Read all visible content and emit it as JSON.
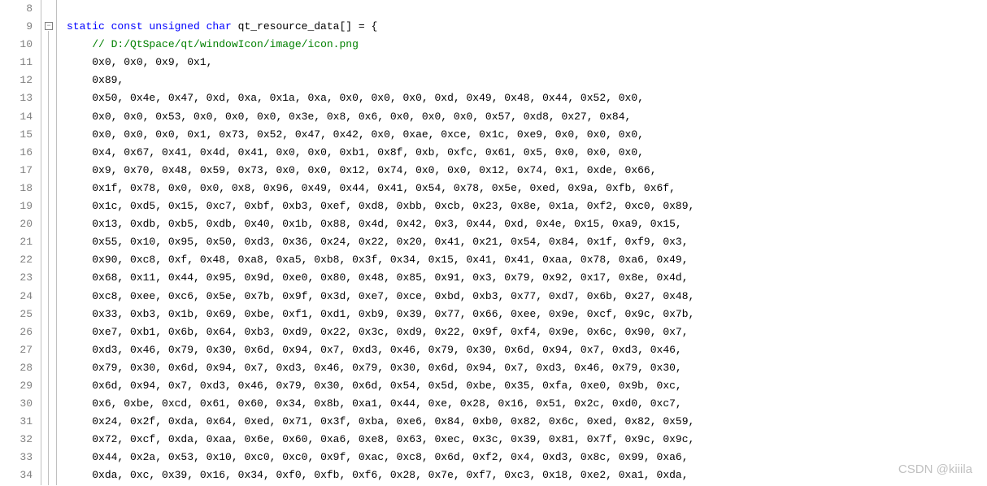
{
  "watermark": "CSDN @kiiila",
  "fold_marker": "−",
  "lines": [
    {
      "num": "8",
      "content": []
    },
    {
      "num": "9",
      "content": [
        {
          "text": "static const unsigned char ",
          "cls": "kw"
        },
        {
          "text": "qt_resource_data[] = {",
          "cls": "ident"
        }
      ]
    },
    {
      "num": "10",
      "indent": "    ",
      "content": [
        {
          "text": "// D:/QtSpace/qt/windowIcon/image/icon.png",
          "cls": "comment"
        }
      ]
    },
    {
      "num": "11",
      "indent": "    ",
      "content": [
        {
          "text": "0x0, 0x0, 0x9, 0x1,",
          "cls": "ident"
        }
      ]
    },
    {
      "num": "12",
      "indent": "    ",
      "content": [
        {
          "text": "0x89,",
          "cls": "ident"
        }
      ]
    },
    {
      "num": "13",
      "indent": "    ",
      "content": [
        {
          "text": "0x50, 0x4e, 0x47, 0xd, 0xa, 0x1a, 0xa, 0x0, 0x0, 0x0, 0xd, 0x49, 0x48, 0x44, 0x52, 0x0,",
          "cls": "ident"
        }
      ]
    },
    {
      "num": "14",
      "indent": "    ",
      "content": [
        {
          "text": "0x0, 0x0, 0x53, 0x0, 0x0, 0x0, 0x3e, 0x8, 0x6, 0x0, 0x0, 0x0, 0x57, 0xd8, 0x27, 0x84,",
          "cls": "ident"
        }
      ]
    },
    {
      "num": "15",
      "indent": "    ",
      "content": [
        {
          "text": "0x0, 0x0, 0x0, 0x1, 0x73, 0x52, 0x47, 0x42, 0x0, 0xae, 0xce, 0x1c, 0xe9, 0x0, 0x0, 0x0,",
          "cls": "ident"
        }
      ]
    },
    {
      "num": "16",
      "indent": "    ",
      "content": [
        {
          "text": "0x4, 0x67, 0x41, 0x4d, 0x41, 0x0, 0x0, 0xb1, 0x8f, 0xb, 0xfc, 0x61, 0x5, 0x0, 0x0, 0x0,",
          "cls": "ident"
        }
      ]
    },
    {
      "num": "17",
      "indent": "    ",
      "content": [
        {
          "text": "0x9, 0x70, 0x48, 0x59, 0x73, 0x0, 0x0, 0x12, 0x74, 0x0, 0x0, 0x12, 0x74, 0x1, 0xde, 0x66,",
          "cls": "ident"
        }
      ]
    },
    {
      "num": "18",
      "indent": "    ",
      "content": [
        {
          "text": "0x1f, 0x78, 0x0, 0x0, 0x8, 0x96, 0x49, 0x44, 0x41, 0x54, 0x78, 0x5e, 0xed, 0x9a, 0xfb, 0x6f,",
          "cls": "ident"
        }
      ]
    },
    {
      "num": "19",
      "indent": "    ",
      "content": [
        {
          "text": "0x1c, 0xd5, 0x15, 0xc7, 0xbf, 0xb3, 0xef, 0xd8, 0xbb, 0xcb, 0x23, 0x8e, 0x1a, 0xf2, 0xc0, 0x89,",
          "cls": "ident"
        }
      ]
    },
    {
      "num": "20",
      "indent": "    ",
      "content": [
        {
          "text": "0x13, 0xdb, 0xb5, 0xdb, 0x40, 0x1b, 0x88, 0x4d, 0x42, 0x3, 0x44, 0xd, 0x4e, 0x15, 0xa9, 0x15,",
          "cls": "ident"
        }
      ]
    },
    {
      "num": "21",
      "indent": "    ",
      "content": [
        {
          "text": "0x55, 0x10, 0x95, 0x50, 0xd3, 0x36, 0x24, 0x22, 0x20, 0x41, 0x21, 0x54, 0x84, 0x1f, 0xf9, 0x3,",
          "cls": "ident"
        }
      ]
    },
    {
      "num": "22",
      "indent": "    ",
      "content": [
        {
          "text": "0x90, 0xc8, 0xf, 0x48, 0xa8, 0xa5, 0xb8, 0x3f, 0x34, 0x15, 0x41, 0x41, 0xaa, 0x78, 0xa6, 0x49,",
          "cls": "ident"
        }
      ]
    },
    {
      "num": "23",
      "indent": "    ",
      "content": [
        {
          "text": "0x68, 0x11, 0x44, 0x95, 0x9d, 0xe0, 0x80, 0x48, 0x85, 0x91, 0x3, 0x79, 0x92, 0x17, 0x8e, 0x4d,",
          "cls": "ident"
        }
      ]
    },
    {
      "num": "24",
      "indent": "    ",
      "content": [
        {
          "text": "0xc8, 0xee, 0xc6, 0x5e, 0x7b, 0x9f, 0x3d, 0xe7, 0xce, 0xbd, 0xb3, 0x77, 0xd7, 0x6b, 0x27, 0x48,",
          "cls": "ident"
        }
      ]
    },
    {
      "num": "25",
      "indent": "    ",
      "content": [
        {
          "text": "0x33, 0xb3, 0x1b, 0x69, 0xbe, 0xf1, 0xd1, 0xb9, 0x39, 0x77, 0x66, 0xee, 0x9e, 0xcf, 0x9c, 0x7b,",
          "cls": "ident"
        }
      ]
    },
    {
      "num": "26",
      "indent": "    ",
      "content": [
        {
          "text": "0xe7, 0xb1, 0x6b, 0x64, 0xb3, 0xd9, 0x22, 0x3c, 0xd9, 0x22, 0x9f, 0xf4, 0x9e, 0x6c, 0x90, 0x7,",
          "cls": "ident"
        }
      ]
    },
    {
      "num": "27",
      "indent": "    ",
      "content": [
        {
          "text": "0xd3, 0x46, 0x79, 0x30, 0x6d, 0x94, 0x7, 0xd3, 0x46, 0x79, 0x30, 0x6d, 0x94, 0x7, 0xd3, 0x46,",
          "cls": "ident"
        }
      ]
    },
    {
      "num": "28",
      "indent": "    ",
      "content": [
        {
          "text": "0x79, 0x30, 0x6d, 0x94, 0x7, 0xd3, 0x46, 0x79, 0x30, 0x6d, 0x94, 0x7, 0xd3, 0x46, 0x79, 0x30,",
          "cls": "ident"
        }
      ]
    },
    {
      "num": "29",
      "indent": "    ",
      "content": [
        {
          "text": "0x6d, 0x94, 0x7, 0xd3, 0x46, 0x79, 0x30, 0x6d, 0x54, 0x5d, 0xbe, 0x35, 0xfa, 0xe0, 0x9b, 0xc,",
          "cls": "ident"
        }
      ]
    },
    {
      "num": "30",
      "indent": "    ",
      "content": [
        {
          "text": "0x6, 0xbe, 0xcd, 0x61, 0x60, 0x34, 0x8b, 0xa1, 0x44, 0xe, 0x28, 0x16, 0x51, 0x2c, 0xd0, 0xc7,",
          "cls": "ident"
        }
      ]
    },
    {
      "num": "31",
      "indent": "    ",
      "content": [
        {
          "text": "0x24, 0x2f, 0xda, 0x64, 0xed, 0x71, 0x3f, 0xba, 0xe6, 0x84, 0xb0, 0x82, 0x6c, 0xed, 0x82, 0x59,",
          "cls": "ident"
        }
      ]
    },
    {
      "num": "32",
      "indent": "    ",
      "content": [
        {
          "text": "0x72, 0xcf, 0xda, 0xaa, 0x6e, 0x60, 0xa6, 0xe8, 0x63, 0xec, 0x3c, 0x39, 0x81, 0x7f, 0x9c, 0x9c,",
          "cls": "ident"
        }
      ]
    },
    {
      "num": "33",
      "indent": "    ",
      "content": [
        {
          "text": "0x44, 0x2a, 0x53, 0x10, 0xc0, 0xc0, 0x9f, 0xac, 0xc8, 0x6d, 0xf2, 0x4, 0xd3, 0x8c, 0x99, 0xa6,",
          "cls": "ident"
        }
      ]
    },
    {
      "num": "34",
      "indent": "    ",
      "content": [
        {
          "text": "0xda, 0xc, 0x39, 0x16, 0x34, 0xf0, 0xfb, 0xf6, 0x28, 0x7e, 0xf7, 0xc3, 0x18, 0xe2, 0xa1, 0xda,",
          "cls": "ident"
        }
      ]
    }
  ]
}
